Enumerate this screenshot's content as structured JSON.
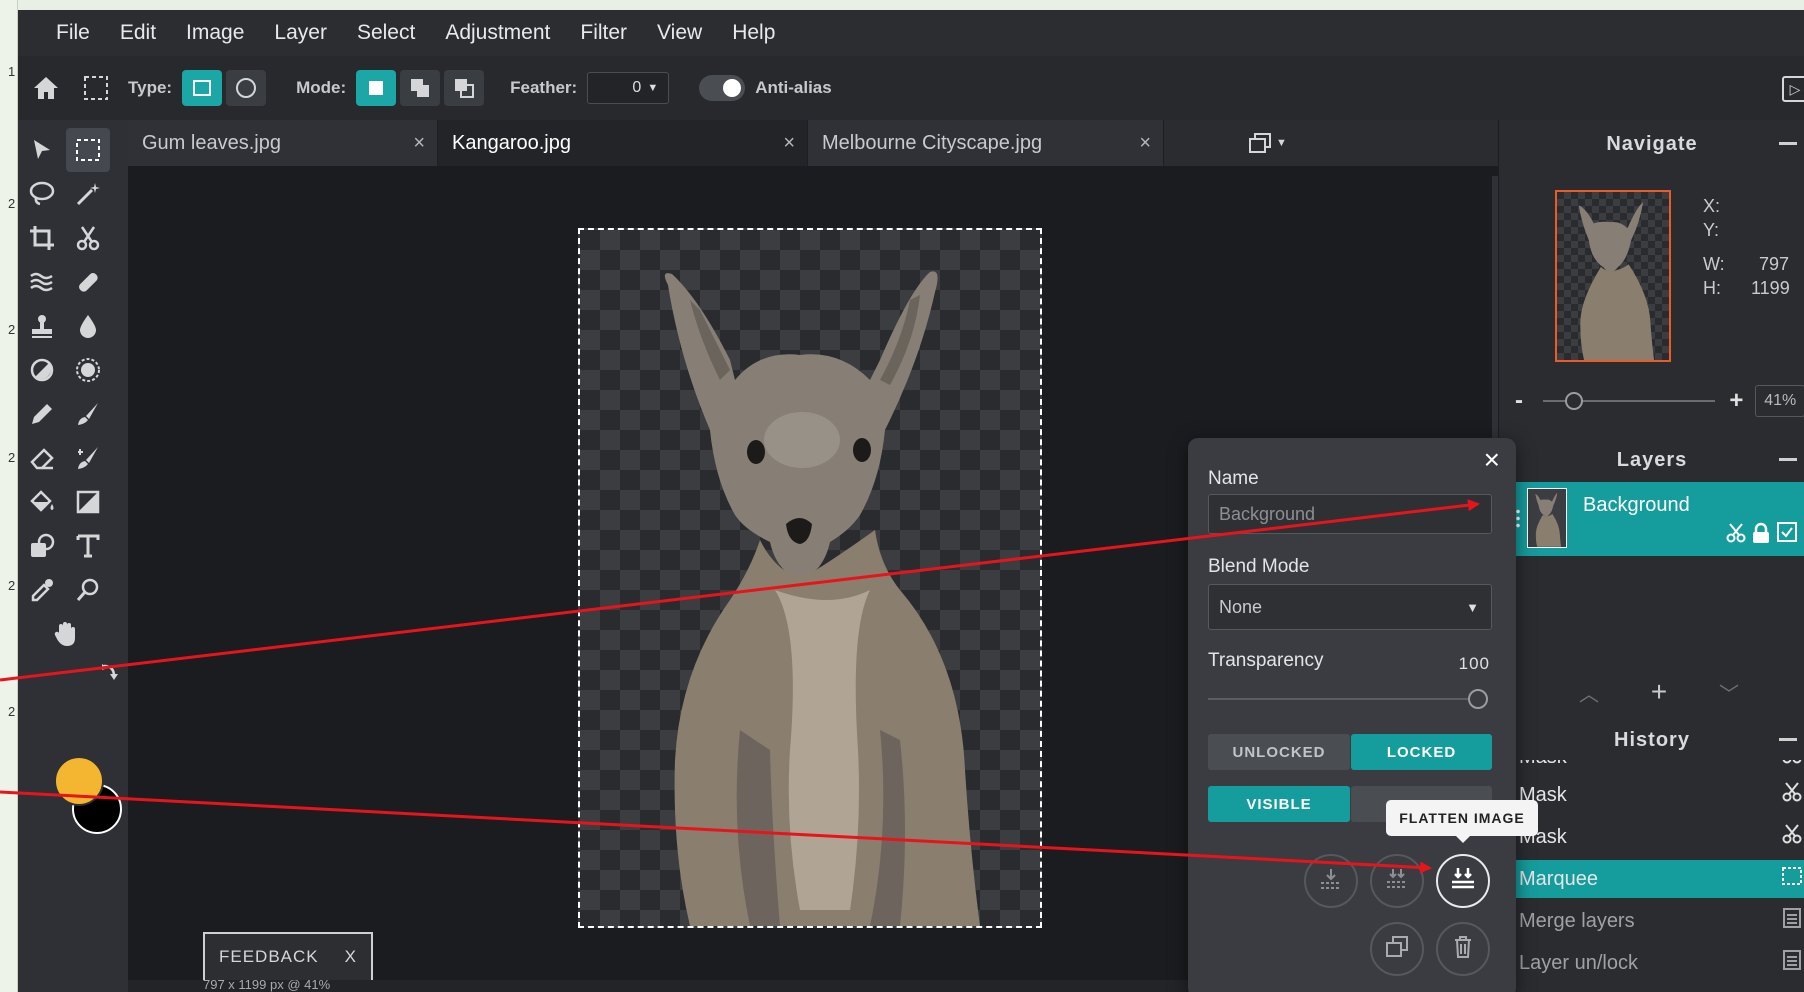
{
  "menu": [
    "File",
    "Edit",
    "Image",
    "Layer",
    "Select",
    "Adjustment",
    "Filter",
    "View",
    "Help"
  ],
  "options": {
    "type_label": "Type:",
    "mode_label": "Mode:",
    "feather_label": "Feather:",
    "feather_value": "0",
    "antialias_label": "Anti-alias"
  },
  "tabs": [
    {
      "label": "Gum leaves.jpg",
      "close": "×"
    },
    {
      "label": "Kangaroo.jpg",
      "close": "×"
    },
    {
      "label": "Melbourne Cityscape.jpg",
      "close": "×"
    }
  ],
  "status": {
    "info": "797 x 1199 px @ 41%"
  },
  "feedback": {
    "label": "FEEDBACK",
    "close": "X"
  },
  "navigate": {
    "title": "Navigate",
    "x_label": "X:",
    "y_label": "Y:",
    "w_label": "W:",
    "w_value": "797",
    "h_label": "H:",
    "h_value": "1199",
    "zoom_minus": "-",
    "zoom_plus": "+",
    "zoom_value": "41%"
  },
  "layers": {
    "title": "Layers",
    "items": [
      {
        "name": "Background"
      }
    ]
  },
  "history": {
    "title": "History",
    "items": [
      {
        "label": "Mask"
      },
      {
        "label": "Mask"
      },
      {
        "label": "Mask"
      },
      {
        "label": "Marquee"
      },
      {
        "label": "Merge layers"
      },
      {
        "label": "Layer un/lock"
      }
    ]
  },
  "layer_props": {
    "name_label": "Name",
    "name_placeholder": "Background",
    "blend_label": "Blend Mode",
    "blend_value": "None",
    "transparency_label": "Transparency",
    "transparency_value": "100",
    "unlocked": "UNLOCKED",
    "locked": "LOCKED",
    "visible": "VISIBLE",
    "tooltip": "FLATTEN IMAGE",
    "close": "×"
  },
  "ruler_marks": [
    "1",
    "2",
    "2",
    "2",
    "2",
    "2"
  ],
  "colors": {
    "accent": "#159c9c",
    "foreground_swatch": "#f4b630",
    "background_swatch": "#000000",
    "annotation": "#e8141c"
  }
}
